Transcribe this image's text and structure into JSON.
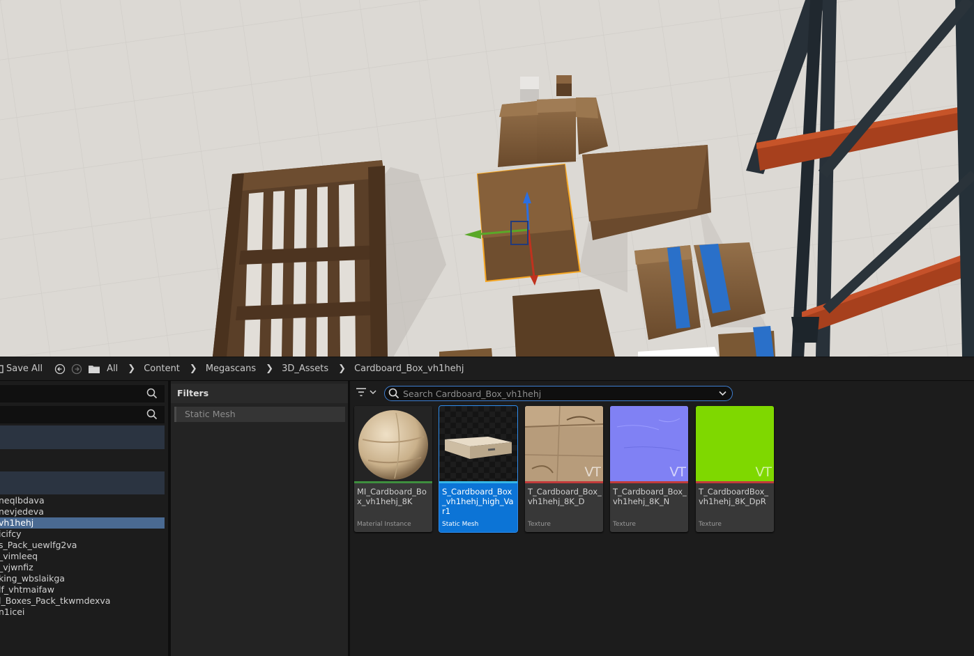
{
  "toolbar": {
    "save_all_label": "Save All",
    "back_icon": "back-arrow-icon",
    "forward_icon": "forward-arrow-icon",
    "folder_icon": "folder-icon"
  },
  "breadcrumb": {
    "items": [
      "All",
      "Content",
      "Megascans",
      "3D_Assets",
      "Cardboard_Box_vh1hehj"
    ]
  },
  "left_panel": {
    "tree_items": [
      {
        "label": "neqlbdava",
        "selected": false
      },
      {
        "label": "nevjedeva",
        "selected": false
      },
      {
        "label": "vh1hehj",
        "selected": true
      },
      {
        "label": "icifcy",
        "selected": false
      },
      {
        "label": "s_Pack_uewlfg2va",
        "selected": false
      },
      {
        "label": "_vimleeq",
        "selected": false
      },
      {
        "label": "_vjwnfiz",
        "selected": false
      },
      {
        "label": "king_wbslaikga",
        "selected": false
      },
      {
        "label": "lf_vhtmaifaw",
        "selected": false
      },
      {
        "label": "l_Boxes_Pack_tkwmdexva",
        "selected": false
      },
      {
        "label": "n1icei",
        "selected": false
      }
    ]
  },
  "filters": {
    "header": "Filters",
    "active_filter": "Static Mesh"
  },
  "asset_search": {
    "placeholder": "Search Cardboard_Box_vh1hehj"
  },
  "assets": [
    {
      "name": "MI_Cardboard_Box_vh1hehj_8K",
      "type": "Material Instance",
      "color_bar": "#3e8f3e",
      "selected": false,
      "vt": false
    },
    {
      "name": "S_Cardboard_Box_vh1hehj_high_Var1",
      "type": "Static Mesh",
      "color_bar": "#35b6e6",
      "selected": true,
      "vt": false
    },
    {
      "name": "T_Cardboard_Box_vh1hehj_8K_D",
      "type": "Texture",
      "color_bar": "#c23b3b",
      "selected": false,
      "vt": true
    },
    {
      "name": "T_Cardboard_Box_vh1hehj_8K_N",
      "type": "Texture",
      "color_bar": "#c23b3b",
      "selected": false,
      "vt": true
    },
    {
      "name": "T_CardboardBox_vh1hehj_8K_DpR",
      "type": "Texture",
      "color_bar": "#c23b3b",
      "selected": false,
      "vt": true
    }
  ],
  "vt_label": "VT",
  "colors": {
    "selection": "#0c74d6",
    "search_border": "#3f7fd1",
    "green_texture": "#7fd800",
    "normal_texture": "#7f80f5"
  }
}
